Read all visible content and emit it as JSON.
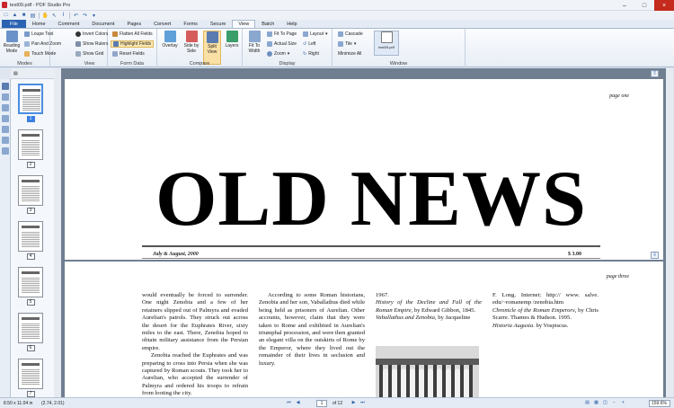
{
  "app": {
    "window_title": "test09.pdf - PDF Studio Pro"
  },
  "tabs": [
    "File",
    "Home",
    "Comment",
    "Document",
    "Pages",
    "Convert",
    "Forms",
    "Secure",
    "View",
    "Batch",
    "Help"
  ],
  "active_tab": "View",
  "ribbon": {
    "modes": {
      "label": "Modes",
      "reading_mode": "Reading Mode",
      "loupe": "Loupe Tool",
      "pan_zoom": "Pan And Zoom",
      "touch": "Touch Mode"
    },
    "view": {
      "label": "View",
      "invert": "Invert Colors",
      "rulers": "Show Rulers",
      "grid": "Show Grid"
    },
    "form_data": {
      "label": "Form Data",
      "flatten": "Flatten All Fields",
      "highlight": "Highlight Fields",
      "reset": "Reset Fields"
    },
    "compare": {
      "label": "Compare",
      "overlay": "Overlay",
      "side_by_side": "Side by Side",
      "split": "Split View",
      "layers": "Layers"
    },
    "display": {
      "label": "Display",
      "fit_width": "Fit To Width",
      "fit_page": "Fit To Page",
      "actual": "Actual Size",
      "zoom": "Zoom",
      "layout": "Layout",
      "left": "Left",
      "right": "Right"
    },
    "window": {
      "label": "Window",
      "cascade": "Cascade",
      "tile": "Tile",
      "minimize": "Minimize All",
      "doc": "test09.pdf"
    }
  },
  "thumbnails": [
    "1",
    "2",
    "3",
    "4",
    "5",
    "6",
    "7"
  ],
  "page1": {
    "label": "page one",
    "masthead": "OLD NEWS",
    "date": "July & August, 2000",
    "price": "$ 3.00"
  },
  "page2": {
    "label": "page three",
    "col1_p1": "would eventually be forced to surrender. One night Zenobia and a few of her retainers slipped out of Palmyra and evaded Aurelian's patrols. They struck out across the desert for the Euphrates River, sixty miles to the east. There, Zenobia hoped to obtain military assistance from the Persian empire.",
    "col1_p2": "Zenobia reached the Euphrates and was preparing to cross into Persia when she was captured by Roman scouts. They took her to Aurelian, who accepted the surrender of Palmyra and ordered his troops to refrain from looting the city.",
    "col2_p1": "According to some Roman historians, Zenobia and her son, Vaballathus died while being held as prisoners of Aurelian. Other accounts, however, claim that they were taken to Rome and exhibited in Aurelian's triumphal procession, and were then granted an elegant villa on the outskirts of Rome by the Emperor, where they lived out the remainder of their lives in seclusion and luxury.",
    "col3_year": "1967.",
    "col3_ref1_title": "History of the Decline and Fall of the Roman Empire",
    "col3_ref1_rest": ", by Edward Gibbon, 1845.",
    "col3_ref2_title": "Vaballathus and Zenobia",
    "col3_ref2_rest": ", by Jacqueline",
    "col4_a": "F. Long. Internet: http:// www. salve. edu/~romanemp /zenobia.htm",
    "col4_ref_title": "Chronicle of the Roman Emperors",
    "col4_ref_rest": ", by Chris Scarre. Thames & Hudson. 1995.",
    "col4_ref2_title": "Historia Augusta",
    "col4_ref2_rest": ". by Vospiscus."
  },
  "status": {
    "size": "8.50 x 11.04 in",
    "coords": "(2.74, 2.01)",
    "page": "1",
    "of": "of 12",
    "zoom": "159.6%"
  },
  "colors": {
    "file_tab": "#2b62b2",
    "accent": "#4a8de0",
    "doc_bg": "#6f7f90"
  }
}
